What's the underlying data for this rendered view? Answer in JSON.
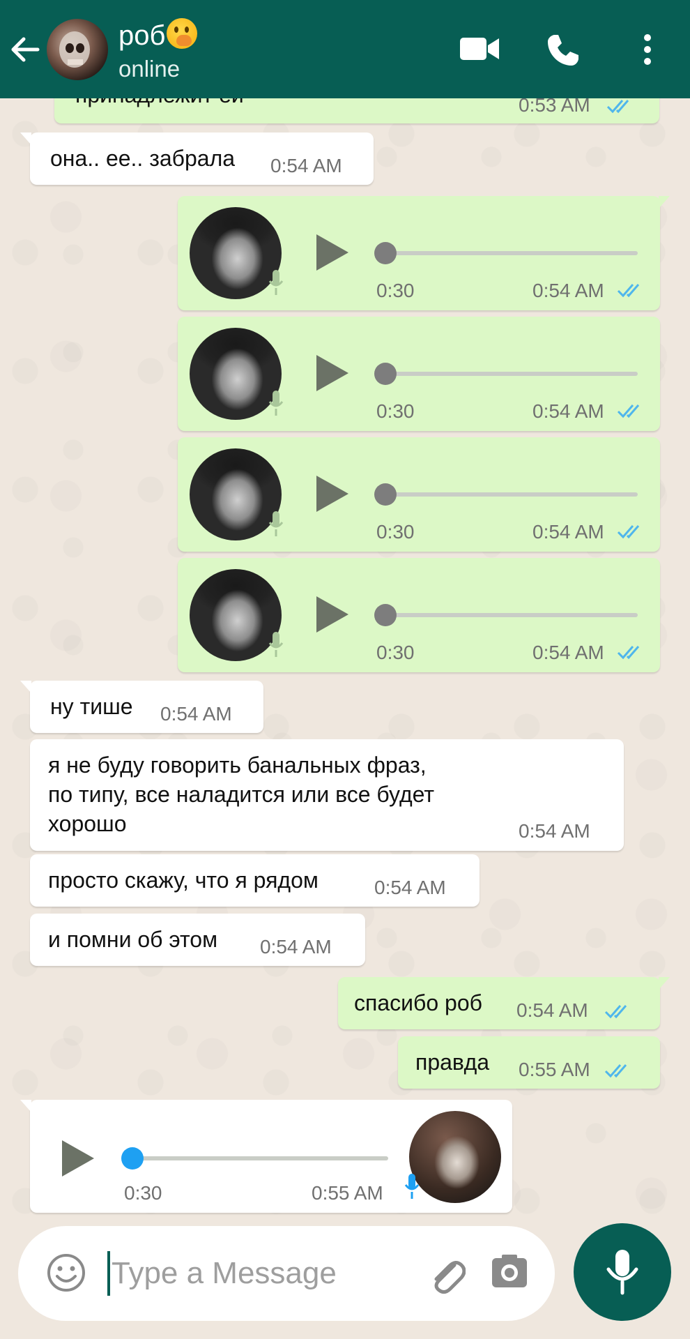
{
  "header": {
    "contact_name": "роб",
    "status": "online",
    "icons": [
      "back-arrow-icon",
      "video-call-icon",
      "phone-icon",
      "more-vertical-icon"
    ]
  },
  "messages": {
    "partial_top_text": "принадлежит ей",
    "partial_top_time": "0:53 AM",
    "m1_text": "она.. ее.. забрала",
    "m1_time": "0:54 AM",
    "voice1": {
      "duration": "0:30",
      "time": "0:54 AM"
    },
    "voice2": {
      "duration": "0:30",
      "time": "0:54 AM"
    },
    "voice3": {
      "duration": "0:30",
      "time": "0:54 AM"
    },
    "voice4": {
      "duration": "0:30",
      "time": "0:54 AM"
    },
    "m2_text": "ну тише",
    "m2_time": "0:54 AM",
    "m3_text": "я не буду говорить банальных фраз,\nпо типу, все наладится или все будет\nхорошо",
    "m3_time": "0:54 AM",
    "m4_text": "просто скажу, что я рядом",
    "m4_time": "0:54 AM",
    "m5_text": "и помни об этом",
    "m5_time": "0:54 AM",
    "m6_text": "спасибо роб",
    "m6_time": "0:54 AM",
    "m7_text": "правда",
    "m7_time": "0:55 AM",
    "voice_in": {
      "duration": "0:30",
      "time": "0:55 AM"
    }
  },
  "composer": {
    "placeholder": "Type a Message"
  },
  "colors": {
    "header": "#075e54",
    "outgoing_bubble": "#dcf8c6",
    "incoming_bubble": "#ffffff",
    "read_ticks": "#4fb6ec",
    "voice_knob_out": "#7d7d7d",
    "voice_knob_in": "#1ea0f2"
  }
}
